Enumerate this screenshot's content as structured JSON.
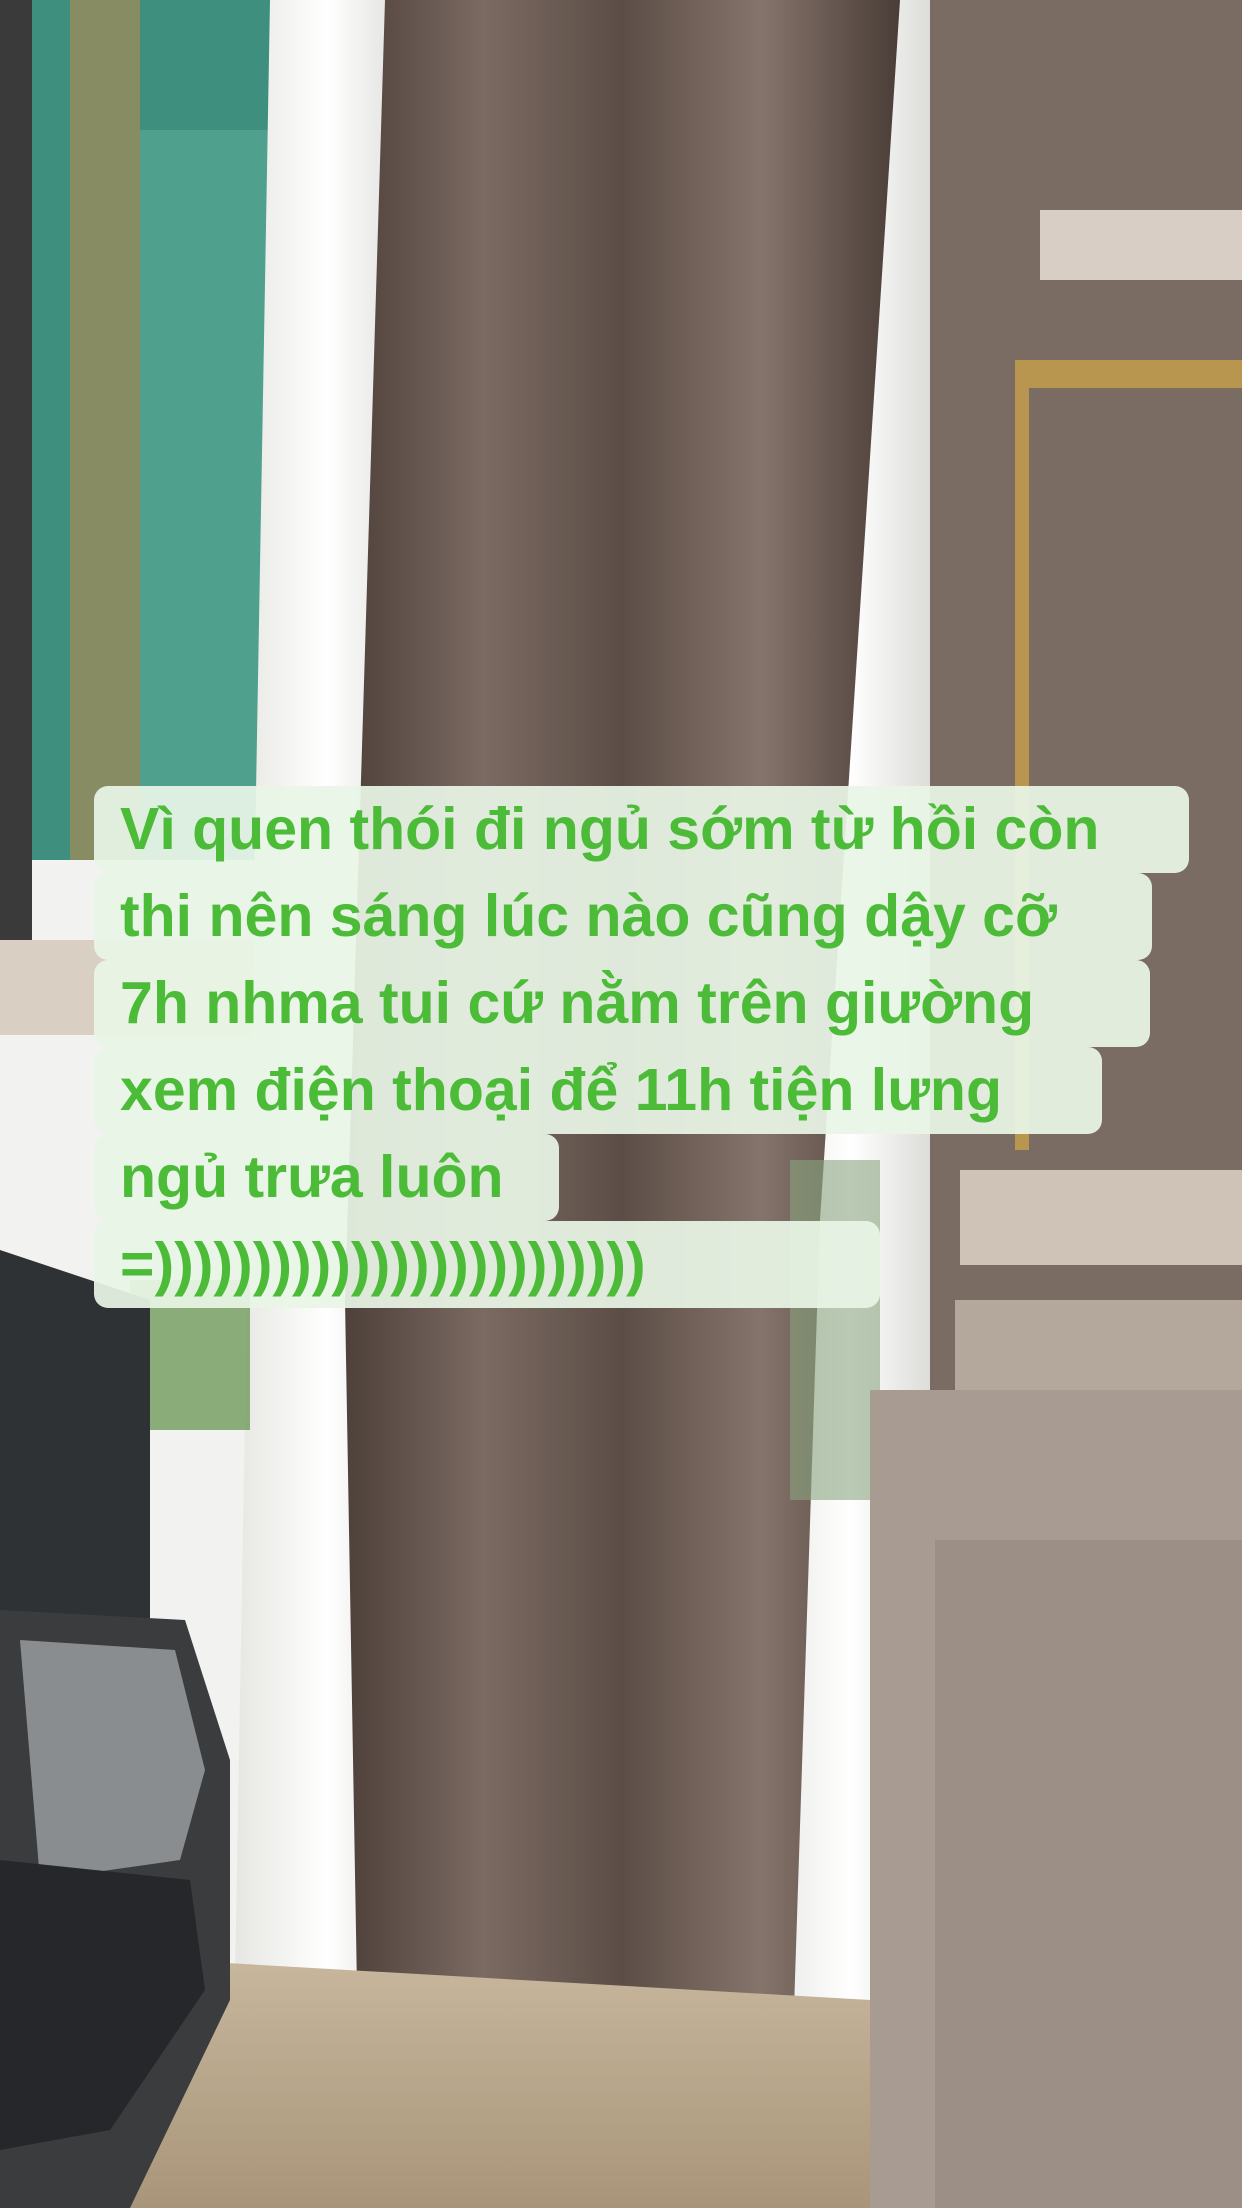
{
  "caption": {
    "lines": [
      "Vì quen thói đi ngủ sớm từ hồi còn",
      "thi nên sáng lúc nào cũng dậy cỡ",
      "7h nhma tui cứ nằm trên giường",
      "xem điện thoại để 11h tiện lưng",
      "ngủ trưa luôn",
      "=)))))))))))))))))))))))))"
    ],
    "color": "#4cbb37",
    "background": "#e8f5e6"
  }
}
